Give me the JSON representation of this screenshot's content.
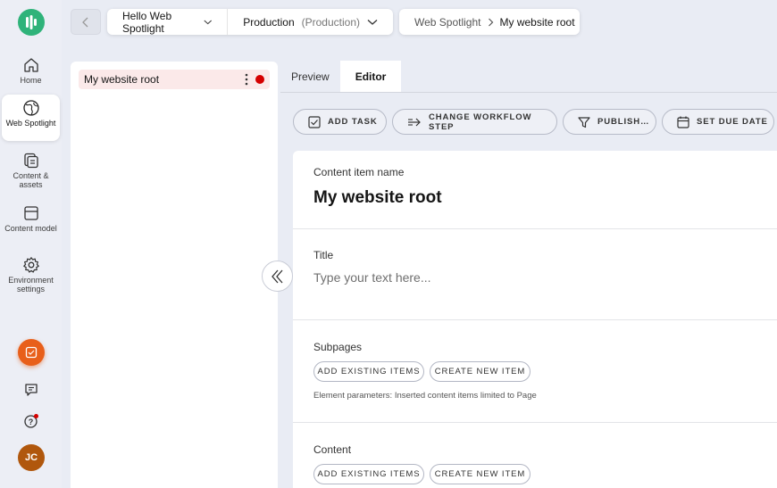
{
  "nav": {
    "items": [
      {
        "label": "Home",
        "icon": "home-icon"
      },
      {
        "label": "Web Spotlight",
        "icon": "globe-icon"
      },
      {
        "label": "Content & assets",
        "icon": "content-icon"
      },
      {
        "label": "Content model",
        "icon": "model-icon"
      },
      {
        "label": "Environment settings",
        "icon": "gear-icon"
      }
    ],
    "avatar_initials": "JC"
  },
  "topbar": {
    "project": "Hello Web Spotlight",
    "environment": "Production",
    "environment_type": "(Production)",
    "breadcrumb": [
      "Web Spotlight",
      "My website root"
    ]
  },
  "tree": {
    "items": [
      {
        "label": "My website root"
      }
    ]
  },
  "tabs": [
    {
      "label": "Preview",
      "active": false
    },
    {
      "label": "Editor",
      "active": true
    }
  ],
  "actions": [
    {
      "label": "ADD TASK",
      "icon": "checkbox-icon"
    },
    {
      "label": "CHANGE WORKFLOW STEP",
      "icon": "workflow-arrow-icon"
    },
    {
      "label": "PUBLISH…",
      "icon": "publish-icon"
    },
    {
      "label": "SET DUE DATE",
      "icon": "calendar-icon"
    }
  ],
  "editor": {
    "name_label": "Content item name",
    "name_value": "My website root",
    "title_label": "Title",
    "title_placeholder": "Type your text here...",
    "subpages_label": "Subpages",
    "subpages_hint": "Element parameters: Inserted content items limited to Page",
    "content_label": "Content",
    "add_existing": "ADD EXISTING ITEMS",
    "create_new": "CREATE NEW ITEM"
  },
  "colors": {
    "brand": "#2fb37a",
    "feedback": "#e85f1a",
    "avatar": "#b0570d",
    "status_dot": "#d50000",
    "tree_highlight": "#fbe9e9"
  }
}
